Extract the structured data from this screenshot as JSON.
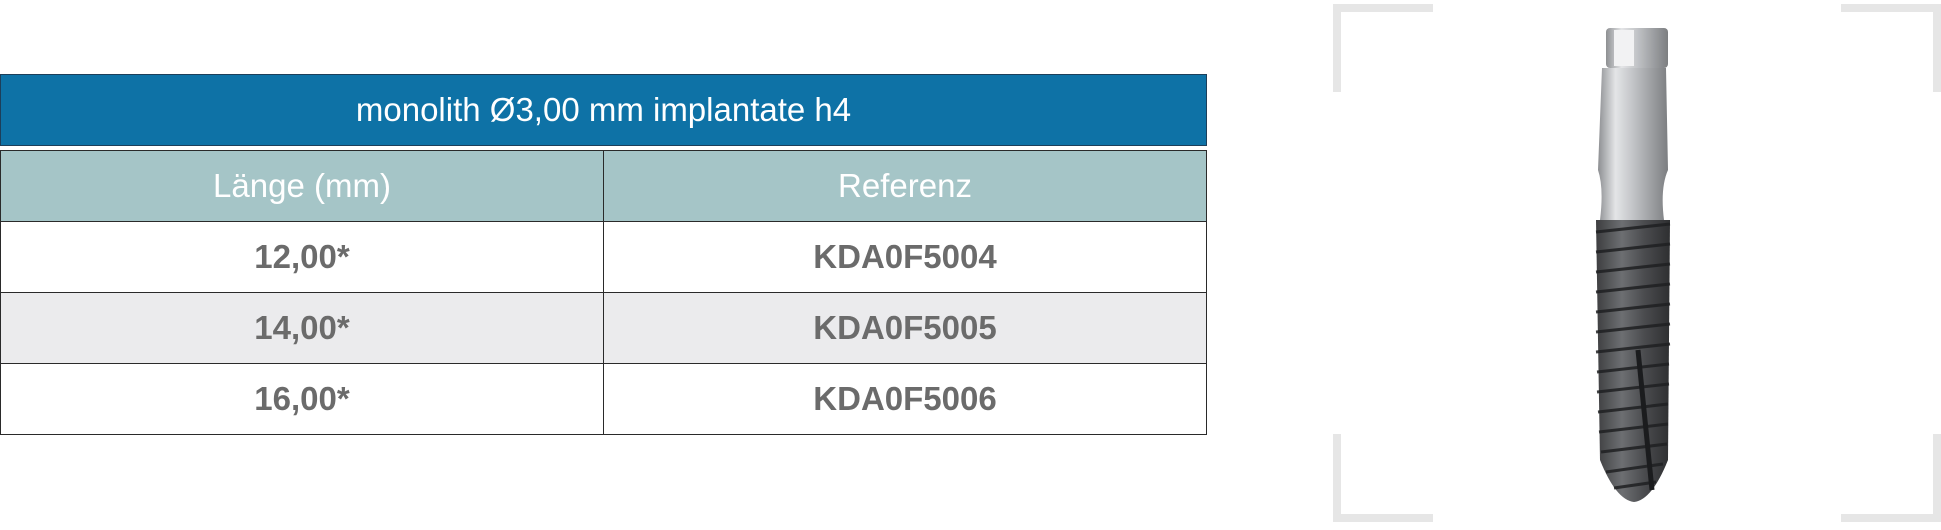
{
  "table": {
    "title": "monolith Ø3,00 mm implantate h4",
    "headers": [
      "Länge (mm)",
      "Referenz"
    ],
    "rows": [
      [
        "12,00*",
        "KDA0F5004"
      ],
      [
        "14,00*",
        "KDA0F5005"
      ],
      [
        "16,00*",
        "KDA0F5006"
      ]
    ]
  },
  "image": {
    "icon": "dental-implant-icon"
  },
  "colors": {
    "title_bg": "#0e72a6",
    "header_bg": "#a5c5c7",
    "alt_row_bg": "#ebebed",
    "body_text": "#6b6b6b",
    "frame_corner": "#e6e6e6"
  }
}
